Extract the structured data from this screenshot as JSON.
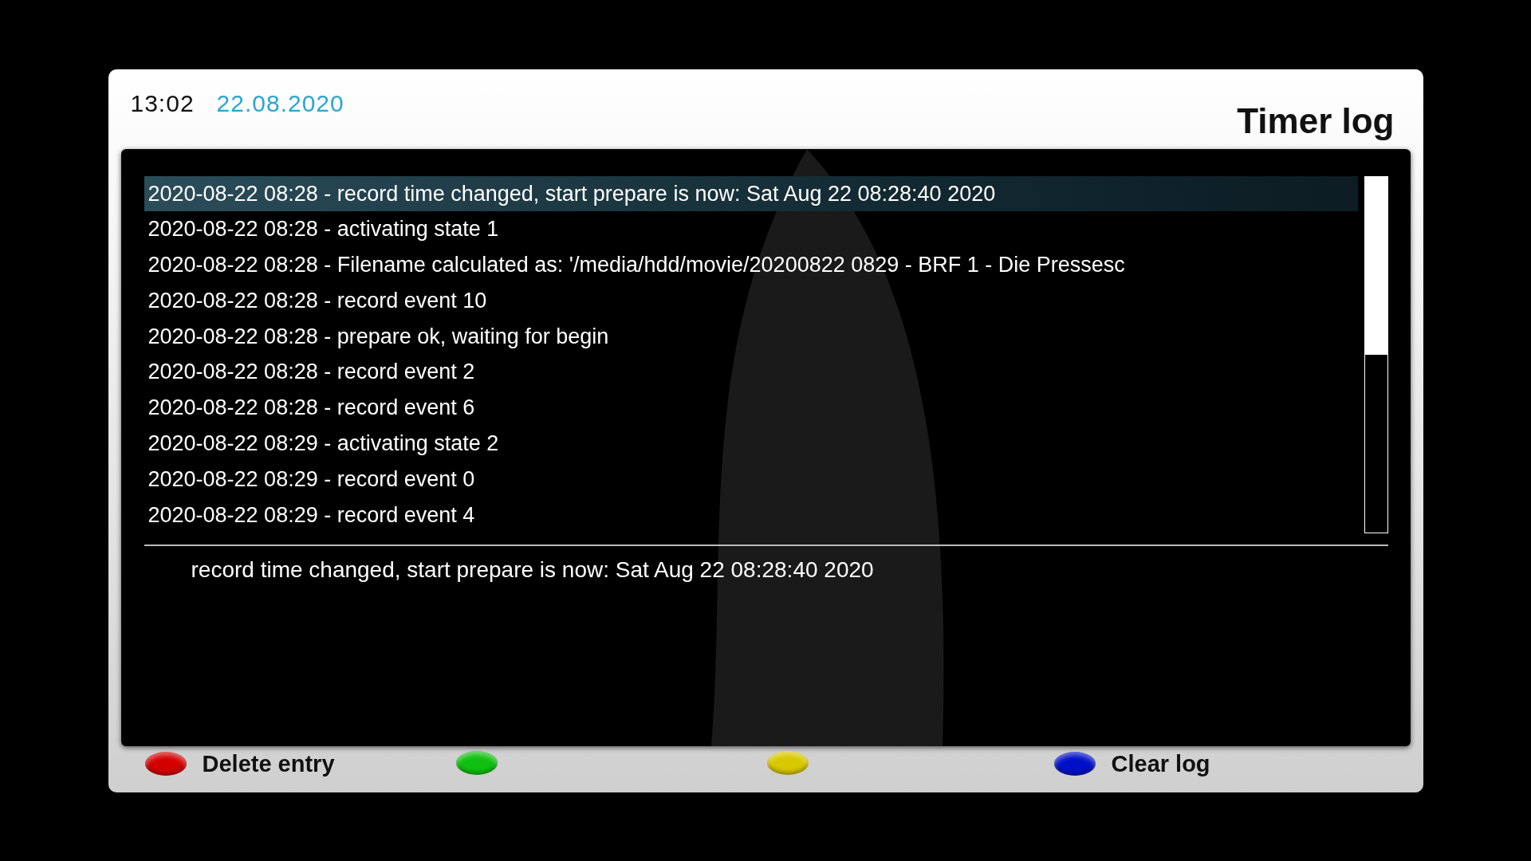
{
  "header": {
    "time": "13:02",
    "date": "22.08.2020",
    "title": "Timer log"
  },
  "rows": [
    {
      "text": "2020-08-22 08:28 - record time changed, start prepare is now: Sat Aug 22 08:28:40 2020",
      "selected": true
    },
    {
      "text": "2020-08-22 08:28 - activating state 1",
      "selected": false
    },
    {
      "text": "2020-08-22 08:28 - Filename calculated as: '/media/hdd/movie/20200822 0829 - BRF 1 - Die Pressesc",
      "selected": false
    },
    {
      "text": "2020-08-22 08:28 - record event 10",
      "selected": false
    },
    {
      "text": "2020-08-22 08:28 - prepare ok, waiting for begin",
      "selected": false
    },
    {
      "text": "2020-08-22 08:28 - record event 2",
      "selected": false
    },
    {
      "text": "2020-08-22 08:28 - record event 6",
      "selected": false
    },
    {
      "text": "2020-08-22 08:29 - activating state 2",
      "selected": false
    },
    {
      "text": "2020-08-22 08:29 - record event 0",
      "selected": false
    },
    {
      "text": "2020-08-22 08:29 - record event 4",
      "selected": false
    }
  ],
  "detail": "record time changed, start prepare is now: Sat Aug 22 08:28:40 2020",
  "footer_buttons": [
    {
      "color": "#d40000",
      "label": "Delete entry"
    },
    {
      "color": "#10c010"
    },
    {
      "color": "#d8c800"
    },
    {
      "color": "#0010c8",
      "label": "Clear log"
    }
  ]
}
